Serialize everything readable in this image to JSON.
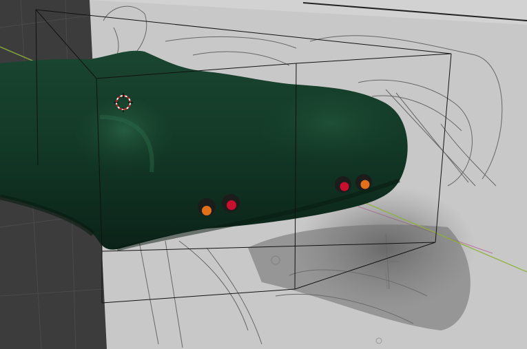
{
  "viewport": {
    "mode": "3D viewport",
    "colors": {
      "background": "#3a3a3a",
      "reference_plane": "#c9c9c9",
      "model": "#143826",
      "model_highlight": "#245a3d",
      "model_shadow": "#0a1f15",
      "light_orange": "#e0701a",
      "light_red": "#c8102e",
      "axis_line": "#8fb23a",
      "bounding_box": "#111111"
    }
  },
  "cursor": {
    "name": "3d-cursor-icon"
  },
  "objects": [
    {
      "name": "car-body-model",
      "color_key": "model"
    },
    {
      "name": "bounding-box",
      "color_key": "bounding_box"
    },
    {
      "name": "blueprint-reference-image",
      "color_key": "reference_plane"
    }
  ],
  "lights": [
    {
      "name": "tail-light-left-outer",
      "color_key": "light_orange"
    },
    {
      "name": "tail-light-left-inner",
      "color_key": "light_red"
    },
    {
      "name": "tail-light-right-inner",
      "color_key": "light_red"
    },
    {
      "name": "tail-light-right-outer",
      "color_key": "light_orange"
    }
  ]
}
